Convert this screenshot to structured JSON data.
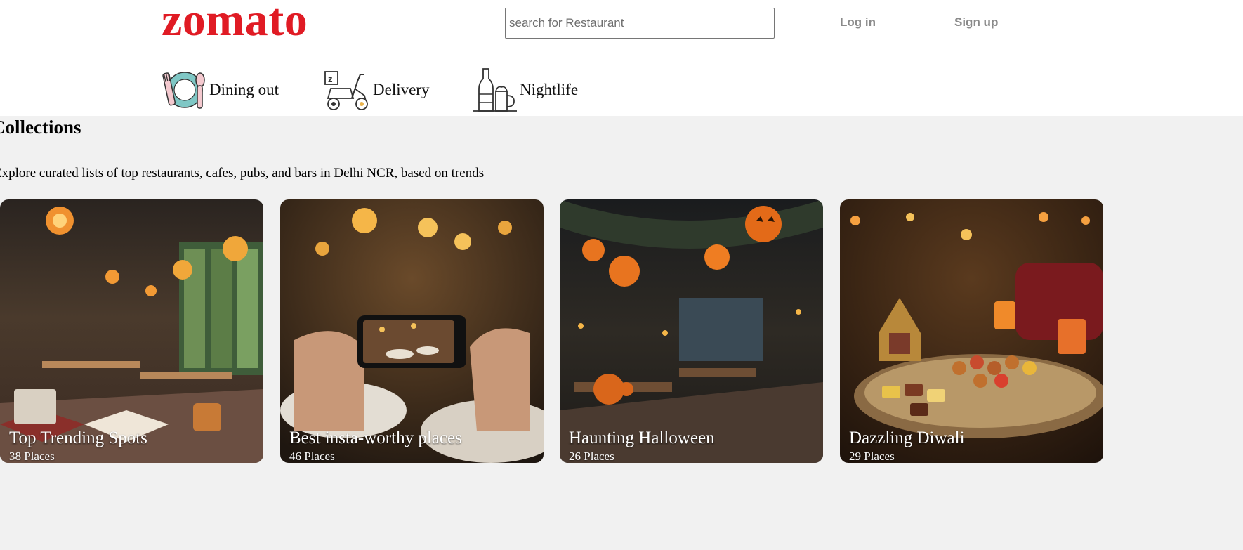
{
  "header": {
    "logo": "zomato",
    "search_placeholder": "search for Restaurant",
    "login_label": "Log in",
    "signup_label": "Sign up"
  },
  "categories": [
    {
      "label": "Dining out",
      "icon": "dining-plate-icon"
    },
    {
      "label": "Delivery",
      "icon": "scooter-icon"
    },
    {
      "label": "Nightlife",
      "icon": "bottle-beer-icon"
    }
  ],
  "collections": {
    "title": "Collections",
    "description": "Explore curated lists of top restaurants, cafes, pubs, and bars in Delhi NCR, based on trends",
    "items": [
      {
        "title": "Top Trending Spots",
        "count": "38 Places"
      },
      {
        "title": "Best insta-worthy places",
        "count": "46 Places"
      },
      {
        "title": "Haunting Halloween",
        "count": "26 Places"
      },
      {
        "title": "Dazzling Diwali",
        "count": "29 Places"
      }
    ]
  },
  "colors": {
    "brand": "#e01b24",
    "page_background": "#f1f1f1",
    "header_background": "#ffffff",
    "auth_text": "#8a8a8a"
  }
}
